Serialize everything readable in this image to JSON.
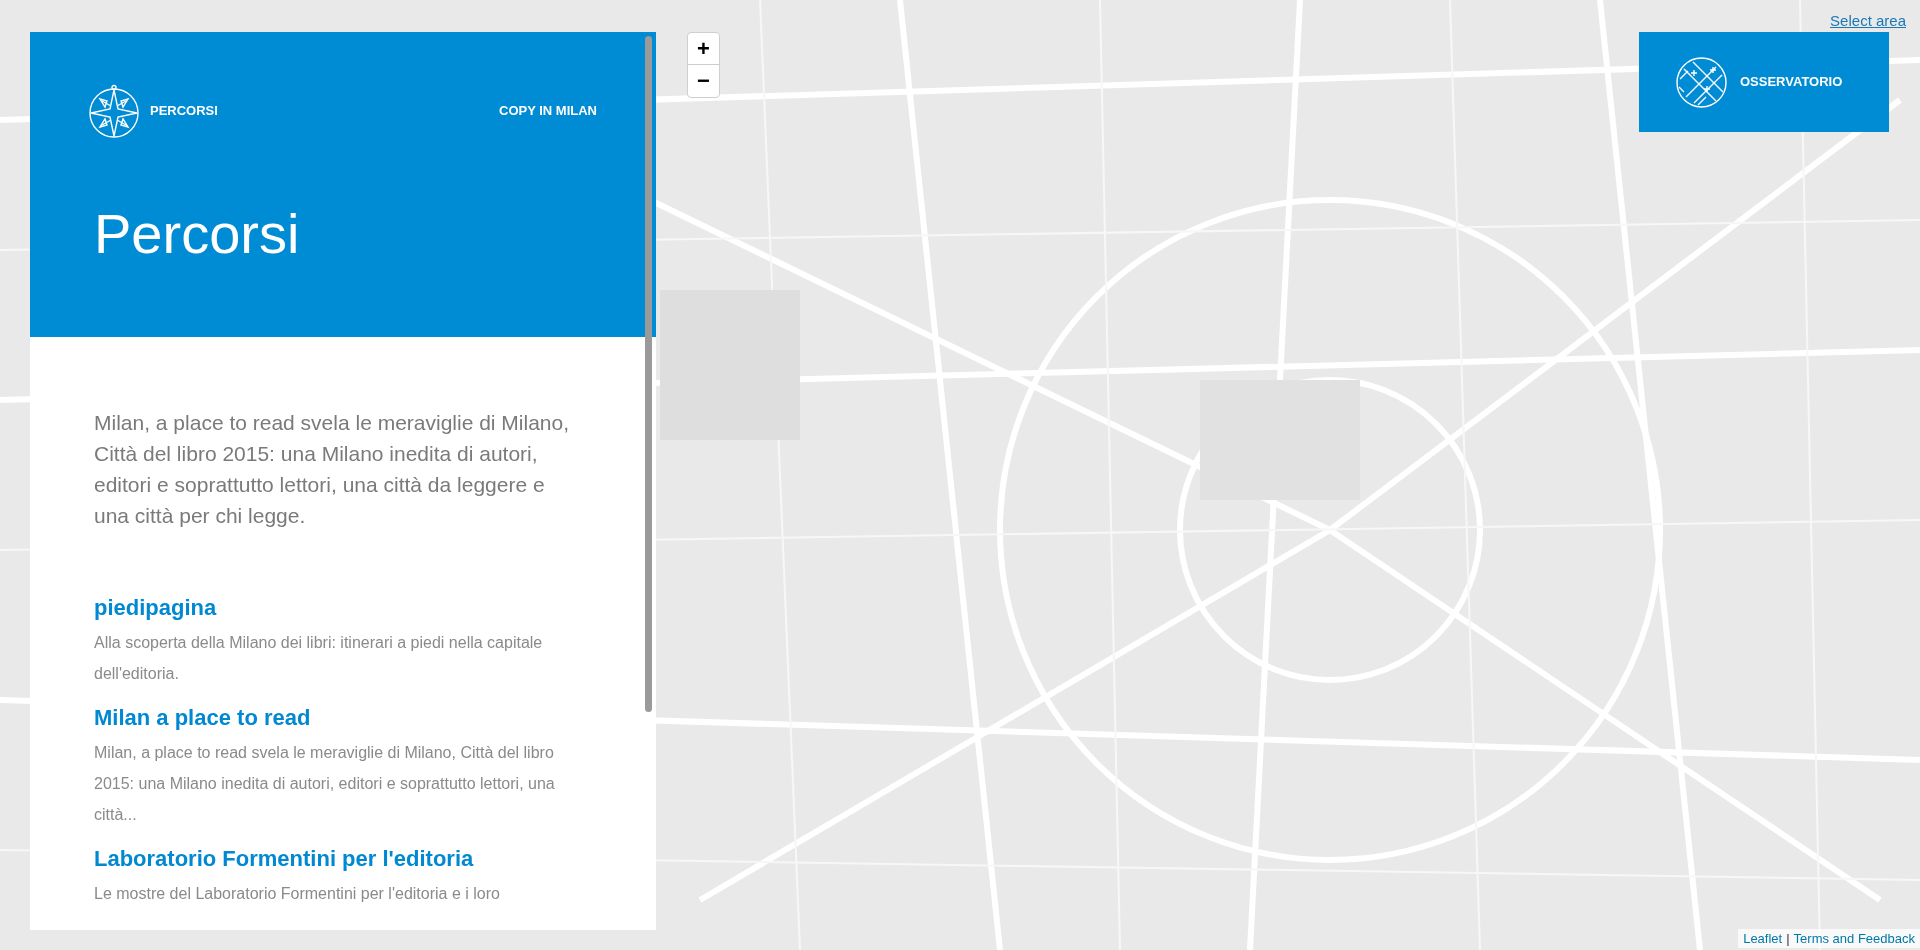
{
  "sidebar": {
    "header": {
      "logo_label": "PERCORSI",
      "nav_link": "COPY IN MILAN",
      "title": "Percorsi"
    },
    "intro": "Milan, a place to read svela le meraviglie di Milano, Città del libro 2015: una Milano inedita di autori, editori e soprattutto lettori, una città da leggere e una città per chi legge.",
    "routes": [
      {
        "title": "piedipagina",
        "description": "Alla scoperta della Milano dei libri: itinerari a piedi nella capitale dell'editoria."
      },
      {
        "title": "Milan a place to read",
        "description": "Milan, a place to read svela le meraviglie di Milano, Città del libro 2015: una Milano inedita di autori, editori e soprattutto lettori, una città..."
      },
      {
        "title": "Laboratorio Formentini per l'editoria",
        "description": "Le mostre del Laboratorio Formentini per l'editoria e i loro"
      }
    ]
  },
  "map": {
    "zoom_controls": [
      "+",
      "−"
    ],
    "select_link": "Select area",
    "overlay_button": "OSSERVATORIO",
    "attribution": {
      "links": [
        "Leaflet",
        "Terms and Feedback"
      ],
      "separator": "|"
    }
  }
}
